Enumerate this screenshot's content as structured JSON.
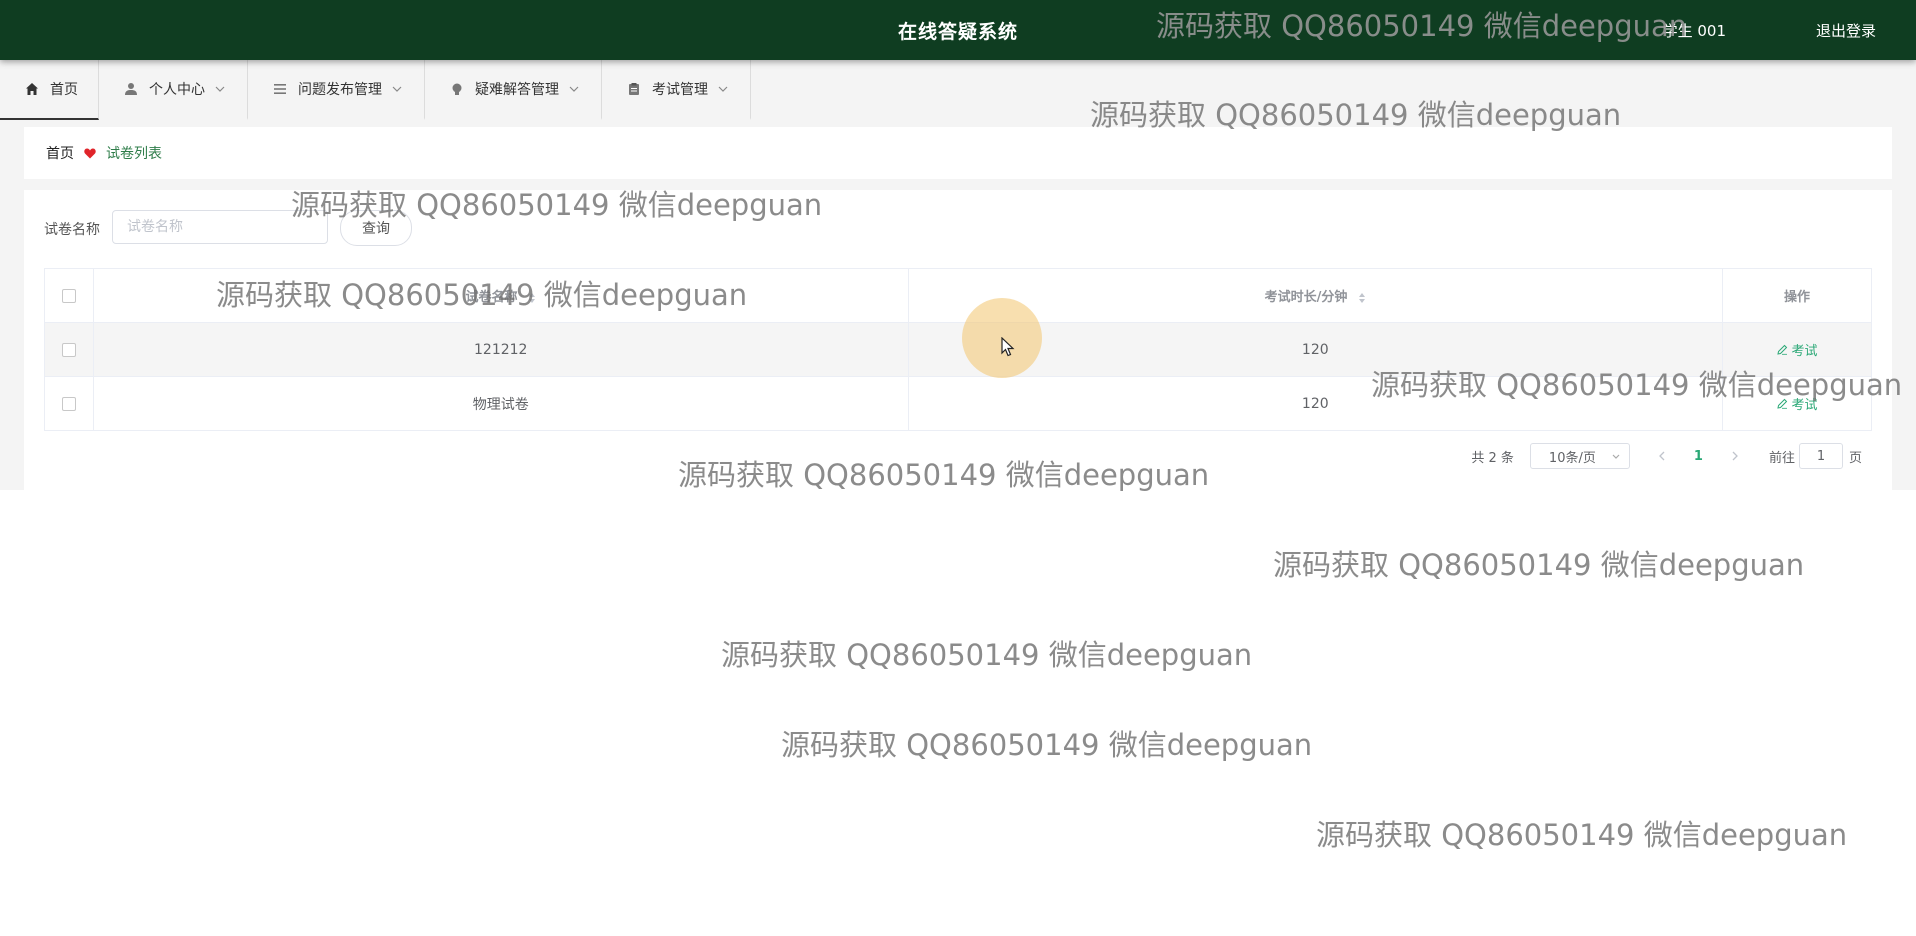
{
  "header": {
    "title": "在线答疑系统",
    "user": "学生 001",
    "logout": "退出登录"
  },
  "nav": {
    "items": [
      {
        "label": "首页",
        "icon": "home-icon",
        "active": true
      },
      {
        "label": "个人中心",
        "icon": "user-icon"
      },
      {
        "label": "问题发布管理",
        "icon": "list-icon"
      },
      {
        "label": "疑难解答管理",
        "icon": "bulb-icon"
      },
      {
        "label": "考试管理",
        "icon": "clipboard-icon"
      }
    ]
  },
  "breadcrumb": {
    "home": "首页",
    "current": "试卷列表"
  },
  "search": {
    "label": "试卷名称",
    "placeholder": "试卷名称",
    "button": "查询"
  },
  "table": {
    "columns": [
      "试卷名称",
      "考试时长/分钟",
      "操作"
    ],
    "rows": [
      {
        "name": "121212",
        "duration": "120",
        "action": "考试"
      },
      {
        "name": "物理试卷",
        "duration": "120",
        "action": "考试"
      }
    ]
  },
  "pagination": {
    "total": "共 2 条",
    "page_size": "10条/页",
    "current_page": "1",
    "goto_label": "前往",
    "goto_value": "1",
    "page_suffix": "页"
  },
  "watermark": "源码获取 QQ86050149 微信deepguan",
  "colors": {
    "header_bg": "#0f3d21",
    "accent": "#2aa876",
    "heart": "#e0242a"
  }
}
